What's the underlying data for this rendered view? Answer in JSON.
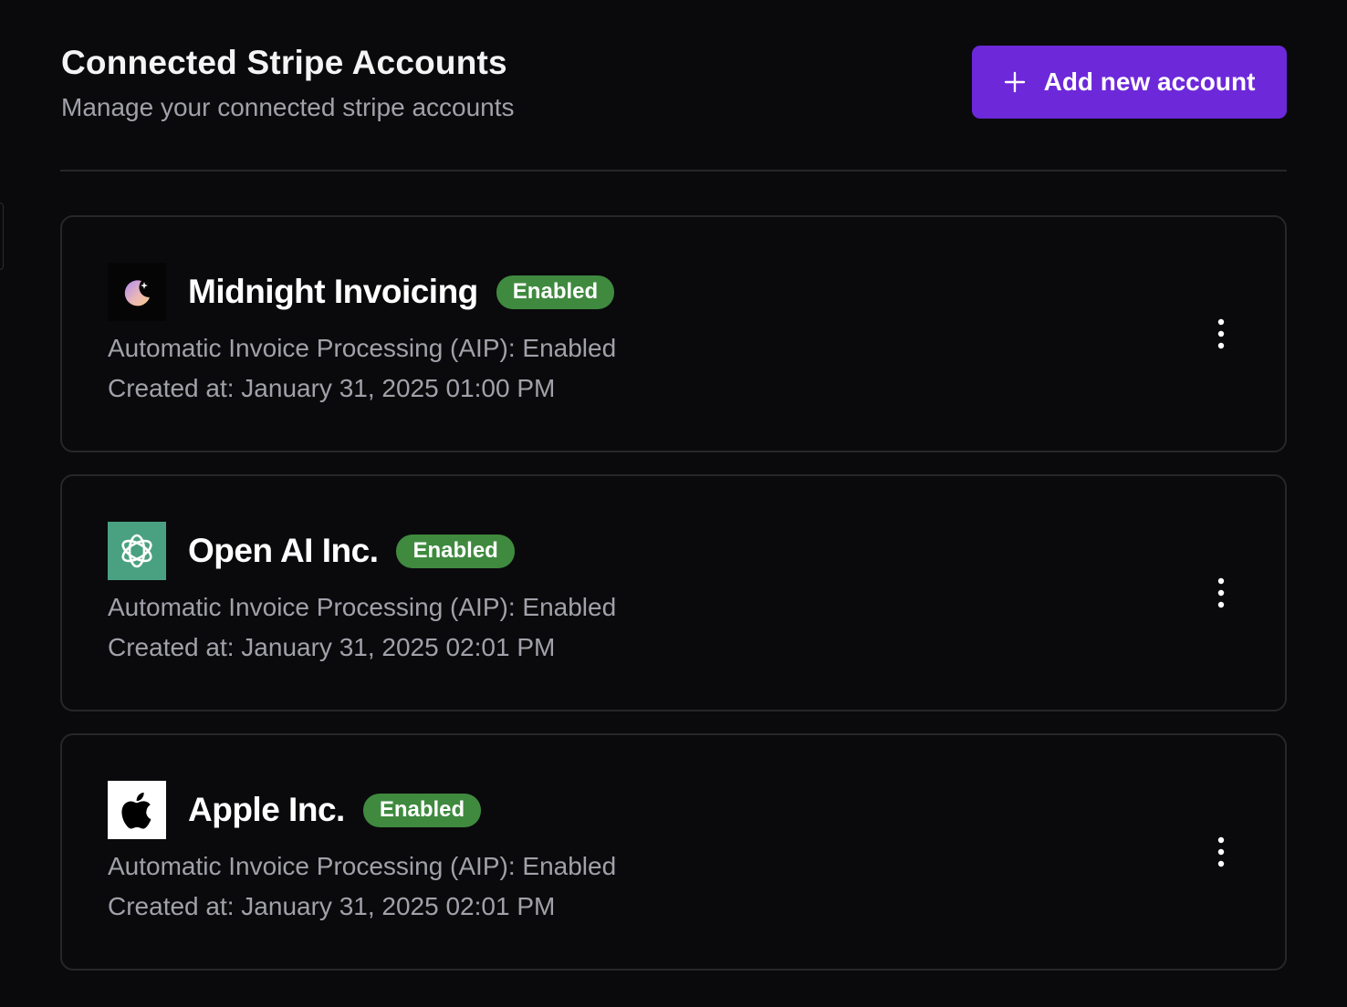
{
  "header": {
    "title": "Connected Stripe Accounts",
    "subtitle": "Manage your connected stripe accounts",
    "add_button_label": "Add new account"
  },
  "colors": {
    "accent": "#6d28d9",
    "badge_green": "#3f8a3f",
    "openai_green": "#4aa181"
  },
  "accounts": [
    {
      "name": "Midnight Invoicing",
      "status": "Enabled",
      "aip": "Automatic Invoice Processing (AIP): Enabled",
      "created": "Created at: January 31, 2025 01:00 PM",
      "icon": "moon-icon"
    },
    {
      "name": "Open AI Inc.",
      "status": "Enabled",
      "aip": "Automatic Invoice Processing (AIP): Enabled",
      "created": "Created at: January 31, 2025 02:01 PM",
      "icon": "openai-icon"
    },
    {
      "name": "Apple Inc.",
      "status": "Enabled",
      "aip": "Automatic Invoice Processing (AIP): Enabled",
      "created": "Created at: January 31, 2025 02:01 PM",
      "icon": "apple-icon"
    }
  ]
}
